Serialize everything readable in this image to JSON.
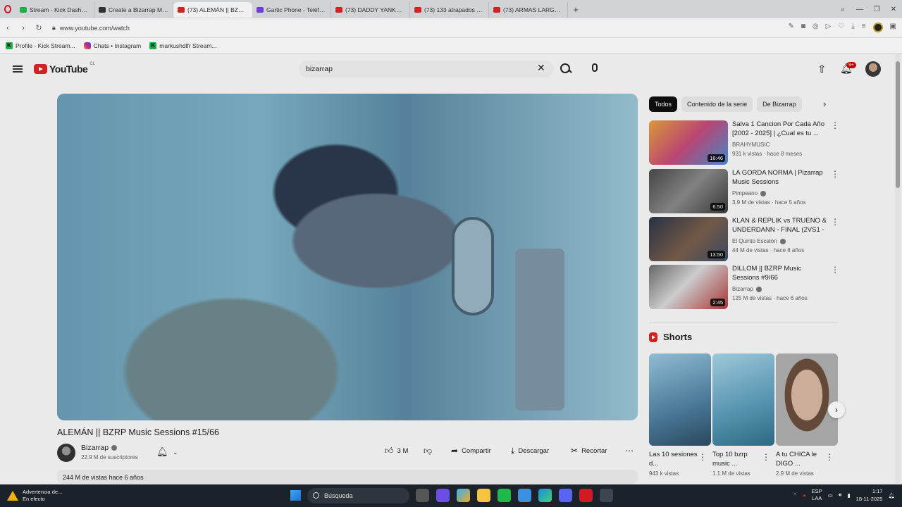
{
  "browser": {
    "tabs": [
      {
        "label": "Stream - Kick Dashbo...",
        "color": "#1fb94b"
      },
      {
        "label": "Create a Bizarrap Music S...",
        "color": "#333333"
      },
      {
        "label": "(73) ALEMÁN || BZRP ...",
        "color": "#e02424"
      },
      {
        "label": "Gartic Phone - Teléfono D...",
        "color": "#7b3fe4"
      },
      {
        "label": "(73) DADDY YANKEE || BZ...",
        "color": "#e02424"
      },
      {
        "label": "(73) 133 atrapados - YouT...",
        "color": "#e02424"
      },
      {
        "label": "(73) ARMAS LARGAS, RAF...",
        "color": "#e02424"
      }
    ],
    "url": "www.youtube.com/watch",
    "bookmarks": [
      {
        "label": "Profile - Kick Stream...",
        "icon": "kick-icon"
      },
      {
        "label": "Chats • Instagram",
        "icon": "instagram-icon"
      },
      {
        "label": "markushdlfr Stream...",
        "icon": "kick-icon"
      }
    ]
  },
  "youtube": {
    "logo_text": "YouTube",
    "country_code": "CL",
    "search_value": "bizarrap",
    "notification_count": "9+",
    "video": {
      "title": "ALEMÁN || BZRP Music Sessions #15/66",
      "channel": "Bizarrap",
      "subscribers": "22.9 M de suscriptores",
      "likes": "3 M",
      "share_label": "Compartir",
      "download_label": "Descargar",
      "clip_label": "Recortar",
      "stats": "244 M de vistas  hace 6 años"
    },
    "chips": [
      "Todos",
      "Contenido de la serie",
      "De Bizarrap"
    ],
    "recommendations": [
      {
        "title": "Salva 1 Cancion Por Cada Año [2002 - 2025] | ¿Cual es tu ...",
        "channel": "BRAHYMUSIC",
        "meta": "931 k vistas · hace 8 meses",
        "duration": "16:46",
        "verified": false
      },
      {
        "title": "LA GORDA NORMA | Pizarrap Music Sessions",
        "channel": "Pimpeano",
        "meta": "3.9 M de vistas · hace 5 años",
        "duration": "6:50",
        "verified": true
      },
      {
        "title": "KLAN & REPLIK vs TRUENO & UNDERDANN - FINAL (2VS1 - ...",
        "channel": "El Quinto Escalón",
        "meta": "44 M de vistas · hace 8 años",
        "duration": "13:50",
        "verified": true
      },
      {
        "title": "DILLOM || BZRP Music Sessions #9/66",
        "channel": "Bizarrap",
        "meta": "125 M de vistas · hace 6 años",
        "duration": "2:45",
        "verified": true
      }
    ],
    "shorts_label": "Shorts",
    "shorts": [
      {
        "title": "Las 10 sesiones d...",
        "views": "943 k vistas"
      },
      {
        "title": "Top 10 bzrp music ...",
        "views": "1.1 M de vistas"
      },
      {
        "title": "A tu CHICA le DIGO ...",
        "views": "2.9 M de vistas"
      }
    ]
  },
  "taskbar": {
    "warning_title": "Advertencia de...",
    "warning_sub": "En efecto",
    "search_placeholder": "Búsqueda",
    "lang_top": "ESP",
    "lang_bottom": "LAA",
    "time": "1:17",
    "date": "18-11-2025"
  }
}
